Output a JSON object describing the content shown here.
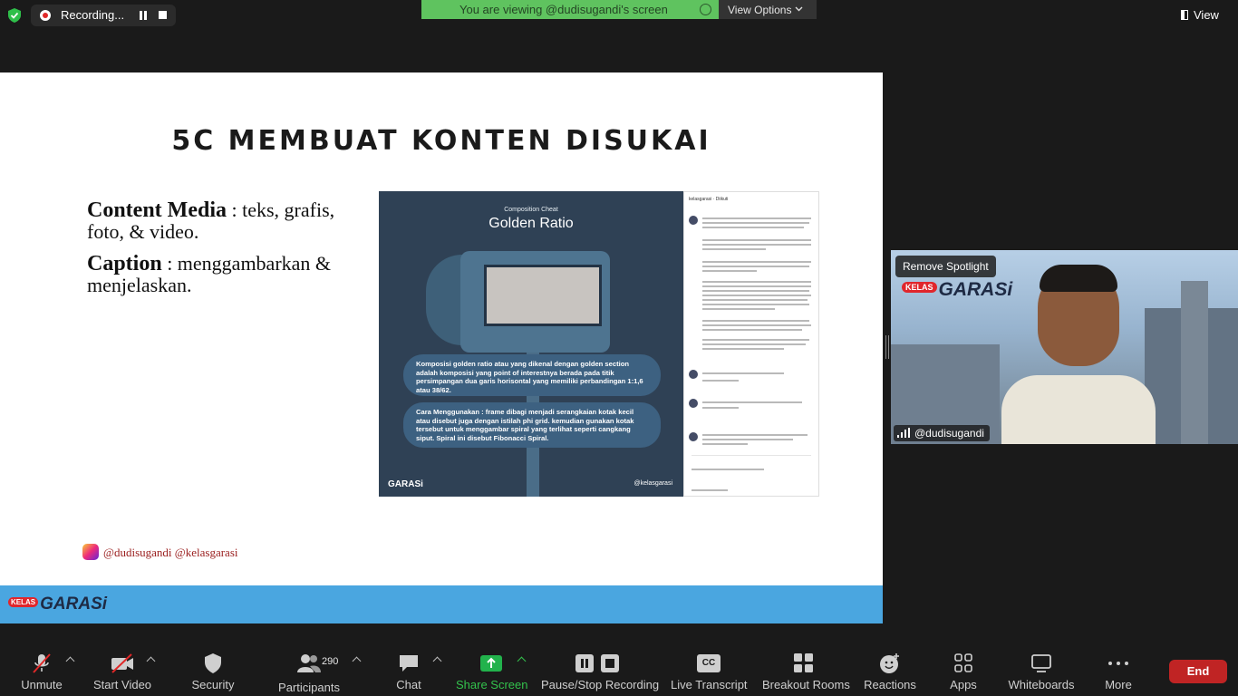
{
  "topbar": {
    "recording_label": "Recording...",
    "viewing_text": "You are viewing @dudisugandi's screen",
    "view_options": "View Options",
    "view_label": "View"
  },
  "slide": {
    "title": "5C MEMBUAT KONTEN DISUKAI",
    "content_heading": "Content Media",
    "content_text": " : teks, grafis, foto, & video.",
    "caption_heading": "Caption",
    "caption_text": " : menggambarkan & menjelaskan.",
    "handle": "@dudisugandi @kelasgarasi",
    "footer_logo_kelas": "KELAS",
    "footer_logo_garasi": "GARASi",
    "infographic": {
      "subtitle": "Composition Cheat",
      "title": "Golden Ratio",
      "panel1": "Komposisi golden ratio atau yang dikenal dengan golden section adalah komposisi yang point of interestnya berada pada titik persimpangan dua garis horisontal yang memiliki perbandingan 1:1,6 atau 38/62.",
      "panel2": "Cara Menggunakan : frame dibagi menjadi serangkaian kotak kecil atau disebut juga dengan istilah phi grid. kemudian gunakan kotak tersebut untuk menggambar spiral yang terlihat seperti cangkang siput. Spiral ini disebut Fibonacci Spiral.",
      "logo": "GARASi",
      "social_handle": "@kelasgarasi"
    },
    "post_header": "kelasgarasi · Diikuti"
  },
  "video": {
    "remove_spotlight": "Remove Spotlight",
    "participant_name": "@dudisugandi",
    "logo_kelas": "KELAS",
    "logo_garasi": "GARASi"
  },
  "toolbar": {
    "unmute": "Unmute",
    "start_video": "Start Video",
    "security": "Security",
    "participants": "Participants",
    "participant_count": "290",
    "chat": "Chat",
    "share_screen": "Share Screen",
    "pause_stop": "Pause/Stop Recording",
    "live_transcript": "Live Transcript",
    "breakout_rooms": "Breakout Rooms",
    "reactions": "Reactions",
    "apps": "Apps",
    "whiteboards": "Whiteboards",
    "more": "More",
    "end": "End"
  },
  "colors": {
    "share_green": "#5fc35f",
    "end_red": "#c02424",
    "slide_footer_blue": "#4aa6e0",
    "share_icon_green": "#22b24c"
  }
}
